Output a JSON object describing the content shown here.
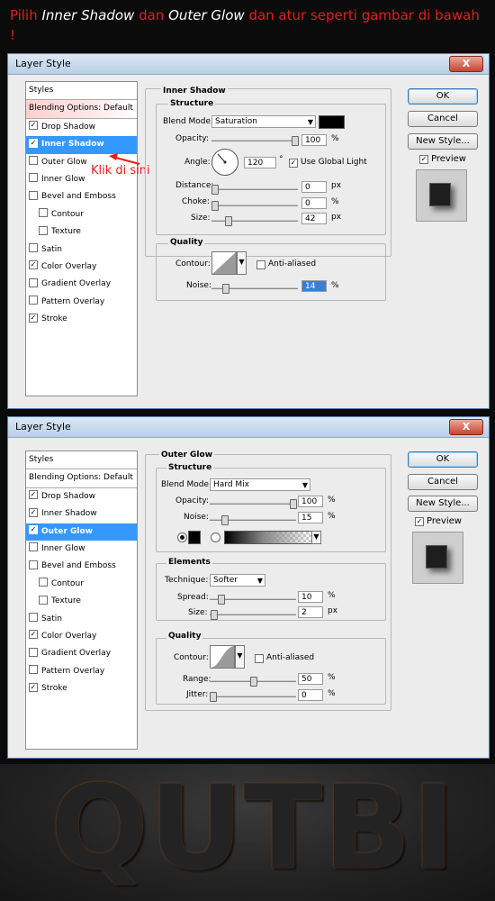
{
  "instruction": {
    "part1": "Pilih ",
    "em1": "Inner Shadow",
    "part2": " dan ",
    "em2": "Outer Glow",
    "part3": " dan atur seperti gambar di bawah !"
  },
  "dialog1": {
    "title": "Layer Style",
    "close": "X",
    "styles_list": {
      "header": "Styles",
      "blending": "Blending Options: Default",
      "items": [
        {
          "label": "Drop Shadow",
          "checked": true
        },
        {
          "label": "Inner Shadow",
          "checked": true
        },
        {
          "label": "Outer Glow",
          "checked": false
        },
        {
          "label": "Inner Glow",
          "checked": false
        },
        {
          "label": "Bevel and Emboss",
          "checked": false
        },
        {
          "label": "Contour",
          "checked": false
        },
        {
          "label": "Texture",
          "checked": false
        },
        {
          "label": "Satin",
          "checked": false
        },
        {
          "label": "Color Overlay",
          "checked": true
        },
        {
          "label": "Gradient Overlay",
          "checked": false
        },
        {
          "label": "Pattern Overlay",
          "checked": false
        },
        {
          "label": "Stroke",
          "checked": true
        }
      ]
    },
    "annotation": "Klik di sini",
    "panel_title": "Inner Shadow",
    "structure": {
      "title": "Structure",
      "blend_mode_label": "Blend Mode:",
      "blend_mode": "Saturation",
      "color": "#000000",
      "opacity_label": "Opacity:",
      "opacity": "100",
      "opacity_unit": "%",
      "opacity_level": 100,
      "angle_label": "Angle:",
      "angle": "120",
      "angle_unit": "°",
      "use_global_light": "Use Global Light",
      "distance_label": "Distance:",
      "distance": "0",
      "distance_unit": "px",
      "distance_level": 0,
      "choke_label": "Choke:",
      "choke": "0",
      "choke_unit": "%",
      "choke_level": 0,
      "size_label": "Size:",
      "size": "42",
      "size_unit": "px",
      "size_level": 17
    },
    "quality": {
      "title": "Quality",
      "contour_label": "Contour:",
      "anti_aliased": "Anti-aliased",
      "noise_label": "Noise:",
      "noise": "14",
      "noise_unit": "%",
      "noise_level": 14
    },
    "buttons": {
      "ok": "OK",
      "reset": "Cancel",
      "new_style": "New Style...",
      "preview": "Preview"
    }
  },
  "dialog2": {
    "title": "Layer Style",
    "close": "X",
    "styles_list": {
      "header": "Styles",
      "blending": "Blending Options: Default",
      "items": [
        {
          "label": "Drop Shadow",
          "checked": true
        },
        {
          "label": "Inner Shadow",
          "checked": true
        },
        {
          "label": "Outer Glow",
          "checked": true
        },
        {
          "label": "Inner Glow",
          "checked": false
        },
        {
          "label": "Bevel and Emboss",
          "checked": false
        },
        {
          "label": "Contour",
          "checked": false
        },
        {
          "label": "Texture",
          "checked": false
        },
        {
          "label": "Satin",
          "checked": false
        },
        {
          "label": "Color Overlay",
          "checked": true
        },
        {
          "label": "Gradient Overlay",
          "checked": false
        },
        {
          "label": "Pattern Overlay",
          "checked": false
        },
        {
          "label": "Stroke",
          "checked": true
        }
      ]
    },
    "panel_title": "Outer Glow",
    "structure": {
      "title": "Structure",
      "blend_mode_label": "Blend Mode:",
      "blend_mode": "Hard Mix",
      "opacity_label": "Opacity:",
      "opacity": "100",
      "opacity_unit": "%",
      "opacity_level": 100,
      "noise_label": "Noise:",
      "noise": "15",
      "noise_unit": "%",
      "noise_level": 15,
      "color": "#000000"
    },
    "elements": {
      "title": "Elements",
      "technique_label": "Technique:",
      "technique": "Softer",
      "spread_label": "Spread:",
      "spread": "10",
      "spread_unit": "%",
      "spread_level": 10,
      "size_label": "Size:",
      "size": "2",
      "size_unit": "px",
      "size_level": 1
    },
    "quality": {
      "title": "Quality",
      "contour_label": "Contour:",
      "anti_aliased": "Anti-aliased",
      "range_label": "Range:",
      "range": "50",
      "range_unit": "%",
      "range_level": 50,
      "jitter_label": "Jitter:",
      "jitter": "0",
      "jitter_unit": "%",
      "jitter_level": 0
    },
    "buttons": {
      "ok": "OK",
      "reset": "Cancel",
      "new_style": "New Style...",
      "preview": "Preview"
    }
  },
  "result_text": "QUTBI",
  "colors": {
    "selection": "#3399ff",
    "instruction": "#e0201c",
    "dialog_bg": "#ececec"
  }
}
